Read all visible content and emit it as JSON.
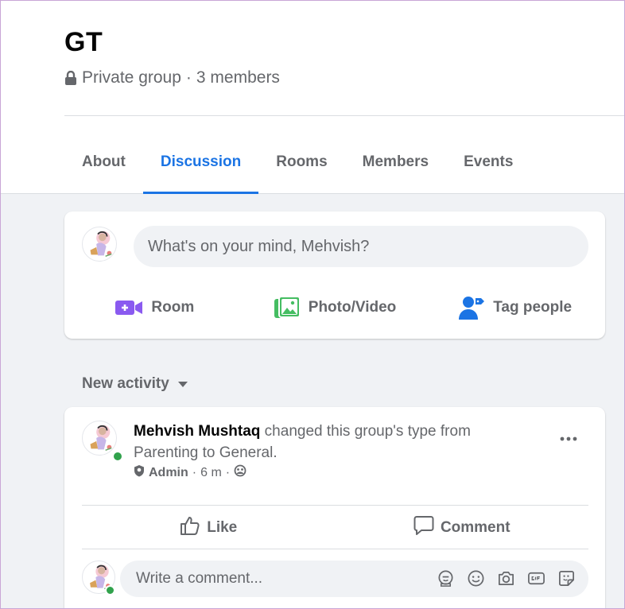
{
  "group": {
    "name": "GT",
    "privacy": "Private group",
    "separator": "·",
    "members": "3 members"
  },
  "tabs": [
    {
      "label": "About",
      "active": false
    },
    {
      "label": "Discussion",
      "active": true
    },
    {
      "label": "Rooms",
      "active": false
    },
    {
      "label": "Members",
      "active": false
    },
    {
      "label": "Events",
      "active": false
    }
  ],
  "composer": {
    "placeholder": "What's on your mind, Mehvish?",
    "actions": [
      {
        "label": "Room",
        "icon": "video-camera-icon",
        "color": "#8a5af0"
      },
      {
        "label": "Photo/Video",
        "icon": "photo-icon",
        "color": "#45bd62"
      },
      {
        "label": "Tag people",
        "icon": "tag-people-icon",
        "color": "#1b74e4"
      }
    ]
  },
  "feed": {
    "filter_label": "New activity"
  },
  "post": {
    "author": "Mehvish Mushtaq",
    "text": " changed this group's type from Parenting to General.",
    "role": "Admin",
    "time": "6 m",
    "meta_separator": "·",
    "like_label": "Like",
    "comment_label": "Comment",
    "comment_placeholder": "Write a comment..."
  },
  "colors": {
    "accent": "#1b74e4",
    "online": "#31a24c",
    "muted_text": "#65676b",
    "background": "#f0f2f5"
  }
}
